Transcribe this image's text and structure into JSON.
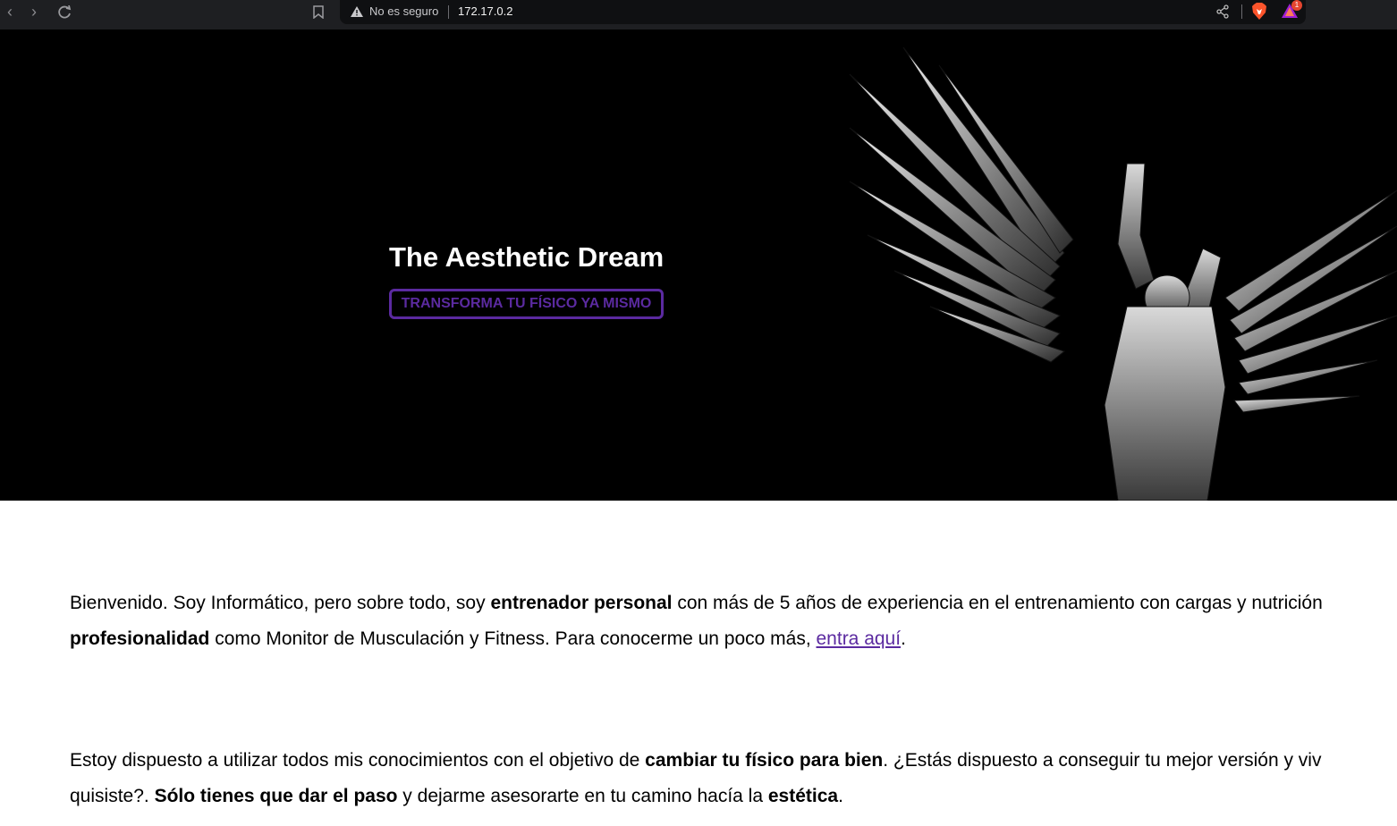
{
  "browser": {
    "security_label": "No es seguro",
    "url": "172.17.0.2",
    "notification_count": "1",
    "icons": [
      "back-icon",
      "forward-icon",
      "reload-icon",
      "bookmark-icon",
      "warning-icon",
      "share-icon",
      "brave-shield-icon",
      "brave-rewards-icon"
    ]
  },
  "hero": {
    "title": "The Aesthetic Dream",
    "cta_label": "TRANSFORMA TU FÍSICO YA MISMO"
  },
  "content": {
    "p1": {
      "t1": "Bienvenido. Soy Informático, pero sobre todo, soy ",
      "b1": "entrenador personal",
      "t2": " con más de 5 años de experiencia en el entrenamiento con cargas y nutrición",
      "b2": "profesionalidad",
      "t3": " como Monitor de Musculación y Fitness. Para conocerme un poco más, ",
      "link": "entra aquí",
      "t4": "."
    },
    "p2": {
      "t1": "Estoy dispuesto a utilizar todos mis conocimientos con el objetivo de ",
      "b1": "cambiar tu físico para bien",
      "t2": ". ¿Estás dispuesto a conseguir tu mejor versión y viv",
      "t3": "quisiste?. ",
      "b2": "Sólo tienes que dar el paso",
      "t4": " y dejarme asesorarte en tu camino hacía la ",
      "b3": "estética",
      "t5": "."
    }
  },
  "colors": {
    "accent": "#5b2aa0",
    "hero_bg": "#000000",
    "toolbar_bg": "#1e1f22"
  }
}
